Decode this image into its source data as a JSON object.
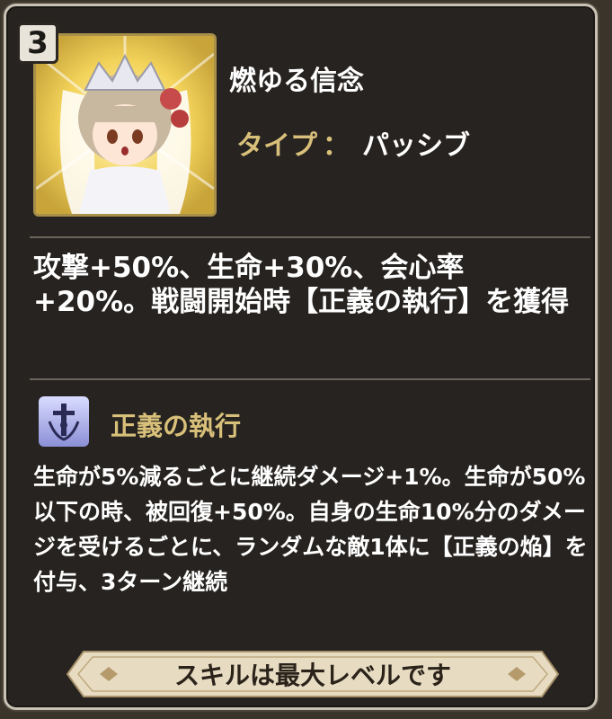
{
  "level_badge": "3",
  "skill": {
    "name": "燃ゆる信念",
    "type_label": "タイプ",
    "type_colon": "：",
    "type_value": "パッシブ",
    "description": "攻撃+50%、生命+30%、会心率+20%。戦闘開始時【正義の執行】を獲得"
  },
  "buff": {
    "icon": "justice-sword-icon",
    "name": "正義の執行",
    "description": "生命が5%減るごとに継続ダメージ+1%。生命が50%以下の時、被回復+50%。自身の生命10%分のダメージを受けるごとに、ランダムな敵1体に【正義の焔】を付与、3ターン継続"
  },
  "footer": {
    "max_level_label": "スキルは最大レベルです"
  },
  "colors": {
    "panel_bg": "#262320",
    "accent_gold": "#d8c07a",
    "text_white": "#ffffff"
  }
}
